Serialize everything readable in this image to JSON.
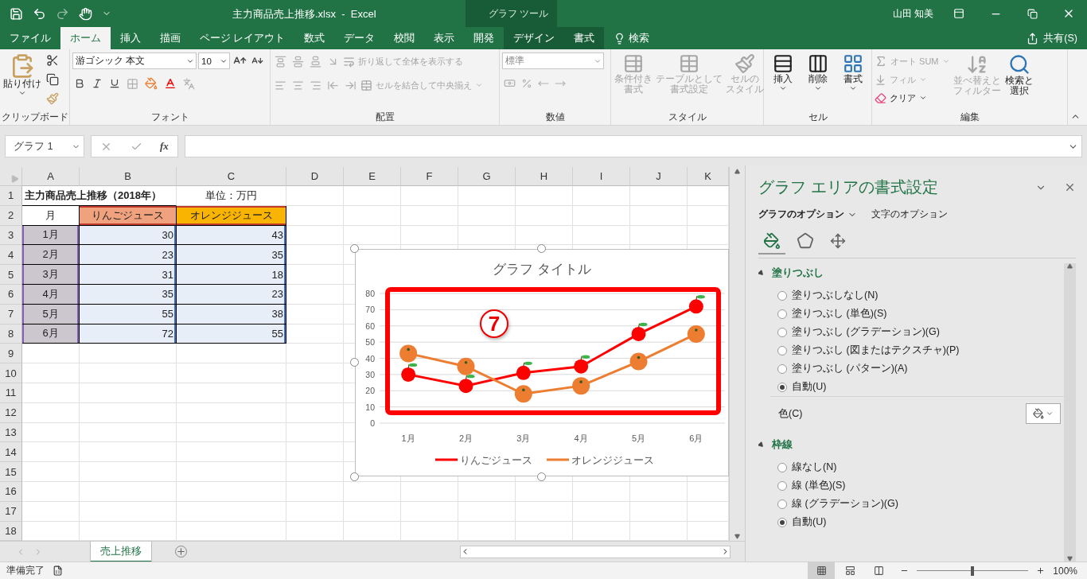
{
  "title_bar": {
    "title": "主力商品売上推移.xlsx  -  Excel",
    "context_group": "グラフ ツール",
    "user": "山田 知美"
  },
  "menu_tabs": [
    {
      "label": "ファイル",
      "selected": false,
      "contextual": false
    },
    {
      "label": "ホーム",
      "selected": true,
      "contextual": false
    },
    {
      "label": "挿入",
      "selected": false,
      "contextual": false
    },
    {
      "label": "描画",
      "selected": false,
      "contextual": false
    },
    {
      "label": "ページ レイアウト",
      "selected": false,
      "contextual": false
    },
    {
      "label": "数式",
      "selected": false,
      "contextual": false
    },
    {
      "label": "データ",
      "selected": false,
      "contextual": false
    },
    {
      "label": "校閲",
      "selected": false,
      "contextual": false
    },
    {
      "label": "表示",
      "selected": false,
      "contextual": false
    },
    {
      "label": "開発",
      "selected": false,
      "contextual": false
    },
    {
      "label": "デザイン",
      "selected": false,
      "contextual": true
    },
    {
      "label": "書式",
      "selected": false,
      "contextual": true
    }
  ],
  "tell_me": "検索",
  "share": "共有(S)",
  "ribbon": [
    {
      "kind": "clipboard",
      "label": "クリップボード",
      "paste": {
        "label": "貼り付け",
        "disabled": false
      }
    },
    {
      "kind": "font",
      "label": "フォント",
      "font_name": "游ゴシック 本文",
      "font_size": "10"
    },
    {
      "kind": "alignment",
      "label": "配置",
      "disabled": true,
      "wrap_text": {
        "label": "折り返して全体を表示する",
        "disabled": true
      },
      "merge": {
        "label": "セルを結合して中央揃え",
        "disabled": true
      }
    },
    {
      "kind": "number",
      "label": "数値",
      "format": "標準",
      "disabled": true
    },
    {
      "kind": "styles",
      "label": "スタイル",
      "buttons": [
        {
          "lines": [
            "条件付き",
            "書式"
          ],
          "disabled": true
        },
        {
          "lines": [
            "テーブルとして",
            "書式設定"
          ],
          "disabled": true
        },
        {
          "lines": [
            "セルの",
            "スタイル"
          ],
          "disabled": true
        }
      ]
    },
    {
      "kind": "cells",
      "label": "セル",
      "buttons": [
        {
          "label": "挿入",
          "disabled": false
        },
        {
          "label": "削除",
          "disabled": false
        },
        {
          "label": "書式",
          "disabled": false
        }
      ]
    },
    {
      "kind": "editing",
      "label": "編集",
      "autosum": {
        "label": "オート SUM",
        "disabled": true
      },
      "fill": {
        "label": "フィル",
        "disabled": true
      },
      "clear": {
        "label": "クリア",
        "disabled": false
      },
      "sort": {
        "lines": [
          "並べ替えと",
          "フィルター"
        ],
        "disabled": true
      },
      "find": {
        "lines": [
          "検索と",
          "選択"
        ],
        "disabled": false
      }
    }
  ],
  "formula_bar": {
    "name_box": "グラフ 1",
    "function_label": "fx"
  },
  "sheet": {
    "columns": [
      "A",
      "B",
      "C",
      "D",
      "E",
      "F",
      "G",
      "H",
      "I",
      "J",
      "K"
    ],
    "rows": [
      {
        "header": "1",
        "cells": [
          {
            "kind": "title",
            "text": "主力商品売上推移（2018年）"
          },
          {
            "kind": "note",
            "text": "単位：万円"
          }
        ]
      },
      {
        "header": "2",
        "cells": [
          {
            "kind": "label",
            "text": "月"
          },
          {
            "kind": "series_header",
            "text": "りんごジュース",
            "color": "#f0a27e"
          },
          {
            "kind": "series_header",
            "text": "オレンジジュース",
            "color": "#f8b400"
          }
        ]
      },
      {
        "header": "3",
        "cells": [
          {
            "kind": "category",
            "text": "1月"
          },
          {
            "kind": "number",
            "text": "30"
          },
          {
            "kind": "number",
            "text": "43"
          }
        ]
      },
      {
        "header": "4",
        "cells": [
          {
            "kind": "category",
            "text": "2月"
          },
          {
            "kind": "number",
            "text": "23"
          },
          {
            "kind": "number",
            "text": "35"
          }
        ]
      },
      {
        "header": "5",
        "cells": [
          {
            "kind": "category",
            "text": "3月"
          },
          {
            "kind": "number",
            "text": "31"
          },
          {
            "kind": "number",
            "text": "18"
          }
        ]
      },
      {
        "header": "6",
        "cells": [
          {
            "kind": "category",
            "text": "4月"
          },
          {
            "kind": "number",
            "text": "35"
          },
          {
            "kind": "number",
            "text": "23"
          }
        ]
      },
      {
        "header": "7",
        "cells": [
          {
            "kind": "category",
            "text": "5月"
          },
          {
            "kind": "number",
            "text": "55"
          },
          {
            "kind": "number",
            "text": "38"
          }
        ]
      },
      {
        "header": "8",
        "cells": [
          {
            "kind": "category",
            "text": "6月"
          },
          {
            "kind": "number",
            "text": "72"
          },
          {
            "kind": "number",
            "text": "55"
          }
        ]
      },
      {
        "header": "9"
      },
      {
        "header": "10"
      },
      {
        "header": "11"
      },
      {
        "header": "12"
      },
      {
        "header": "13"
      },
      {
        "header": "14"
      },
      {
        "header": "15"
      },
      {
        "header": "16"
      },
      {
        "header": "17"
      },
      {
        "header": "18"
      }
    ]
  },
  "chart": {
    "callout": "7",
    "chart_data": {
      "type": "line",
      "title": "グラフ タイトル",
      "categories": [
        "1月",
        "2月",
        "3月",
        "4月",
        "5月",
        "6月"
      ],
      "series": [
        {
          "name": "りんごジュース",
          "color": "#ff0000",
          "marker": "circle",
          "values": [
            30,
            23,
            31,
            35,
            55,
            72
          ]
        },
        {
          "name": "オレンジジュース",
          "color": "#ed7d31",
          "marker": "circle",
          "values": [
            43,
            35,
            18,
            23,
            38,
            55
          ]
        }
      ],
      "ylim": [
        0,
        80
      ],
      "yticks": [
        0,
        10,
        20,
        30,
        40,
        50,
        60,
        70,
        80
      ],
      "grid": true,
      "legend": "lower center"
    }
  },
  "pane": {
    "title": "グラフ エリアの書式設定",
    "option_tabs": [
      {
        "label": "グラフのオプション",
        "selected": true
      },
      {
        "label": "文字のオプション",
        "selected": false
      }
    ],
    "icon_tabs": [
      {
        "selected": true
      },
      {
        "selected": false
      },
      {
        "selected": false
      }
    ],
    "sections": [
      {
        "title": "塗りつぶし",
        "expanded": true,
        "color_label": "色(C)",
        "options": [
          {
            "label": "塗りつぶしなし(N)",
            "selected": false
          },
          {
            "label": "塗りつぶし (単色)(S)",
            "selected": false
          },
          {
            "label": "塗りつぶし (グラデーション)(G)",
            "selected": false
          },
          {
            "label": "塗りつぶし (図またはテクスチャ)(P)",
            "selected": false
          },
          {
            "label": "塗りつぶし (パターン)(A)",
            "selected": false
          },
          {
            "label": "自動(U)",
            "selected": true
          }
        ]
      },
      {
        "title": "枠線",
        "expanded": true,
        "options": [
          {
            "label": "線なし(N)",
            "selected": false
          },
          {
            "label": "線 (単色)(S)",
            "selected": false
          },
          {
            "label": "線 (グラデーション)(G)",
            "selected": false
          },
          {
            "label": "自動(U)",
            "selected": true
          }
        ]
      }
    ]
  },
  "sheet_tabs": [
    {
      "label": "売上推移",
      "selected": true
    }
  ],
  "status_bar": {
    "status": "準備完了",
    "views": [
      {
        "selected": true
      },
      {
        "selected": false
      },
      {
        "selected": false
      }
    ],
    "zoom": {
      "level": 0.5,
      "reading": "100%"
    }
  }
}
